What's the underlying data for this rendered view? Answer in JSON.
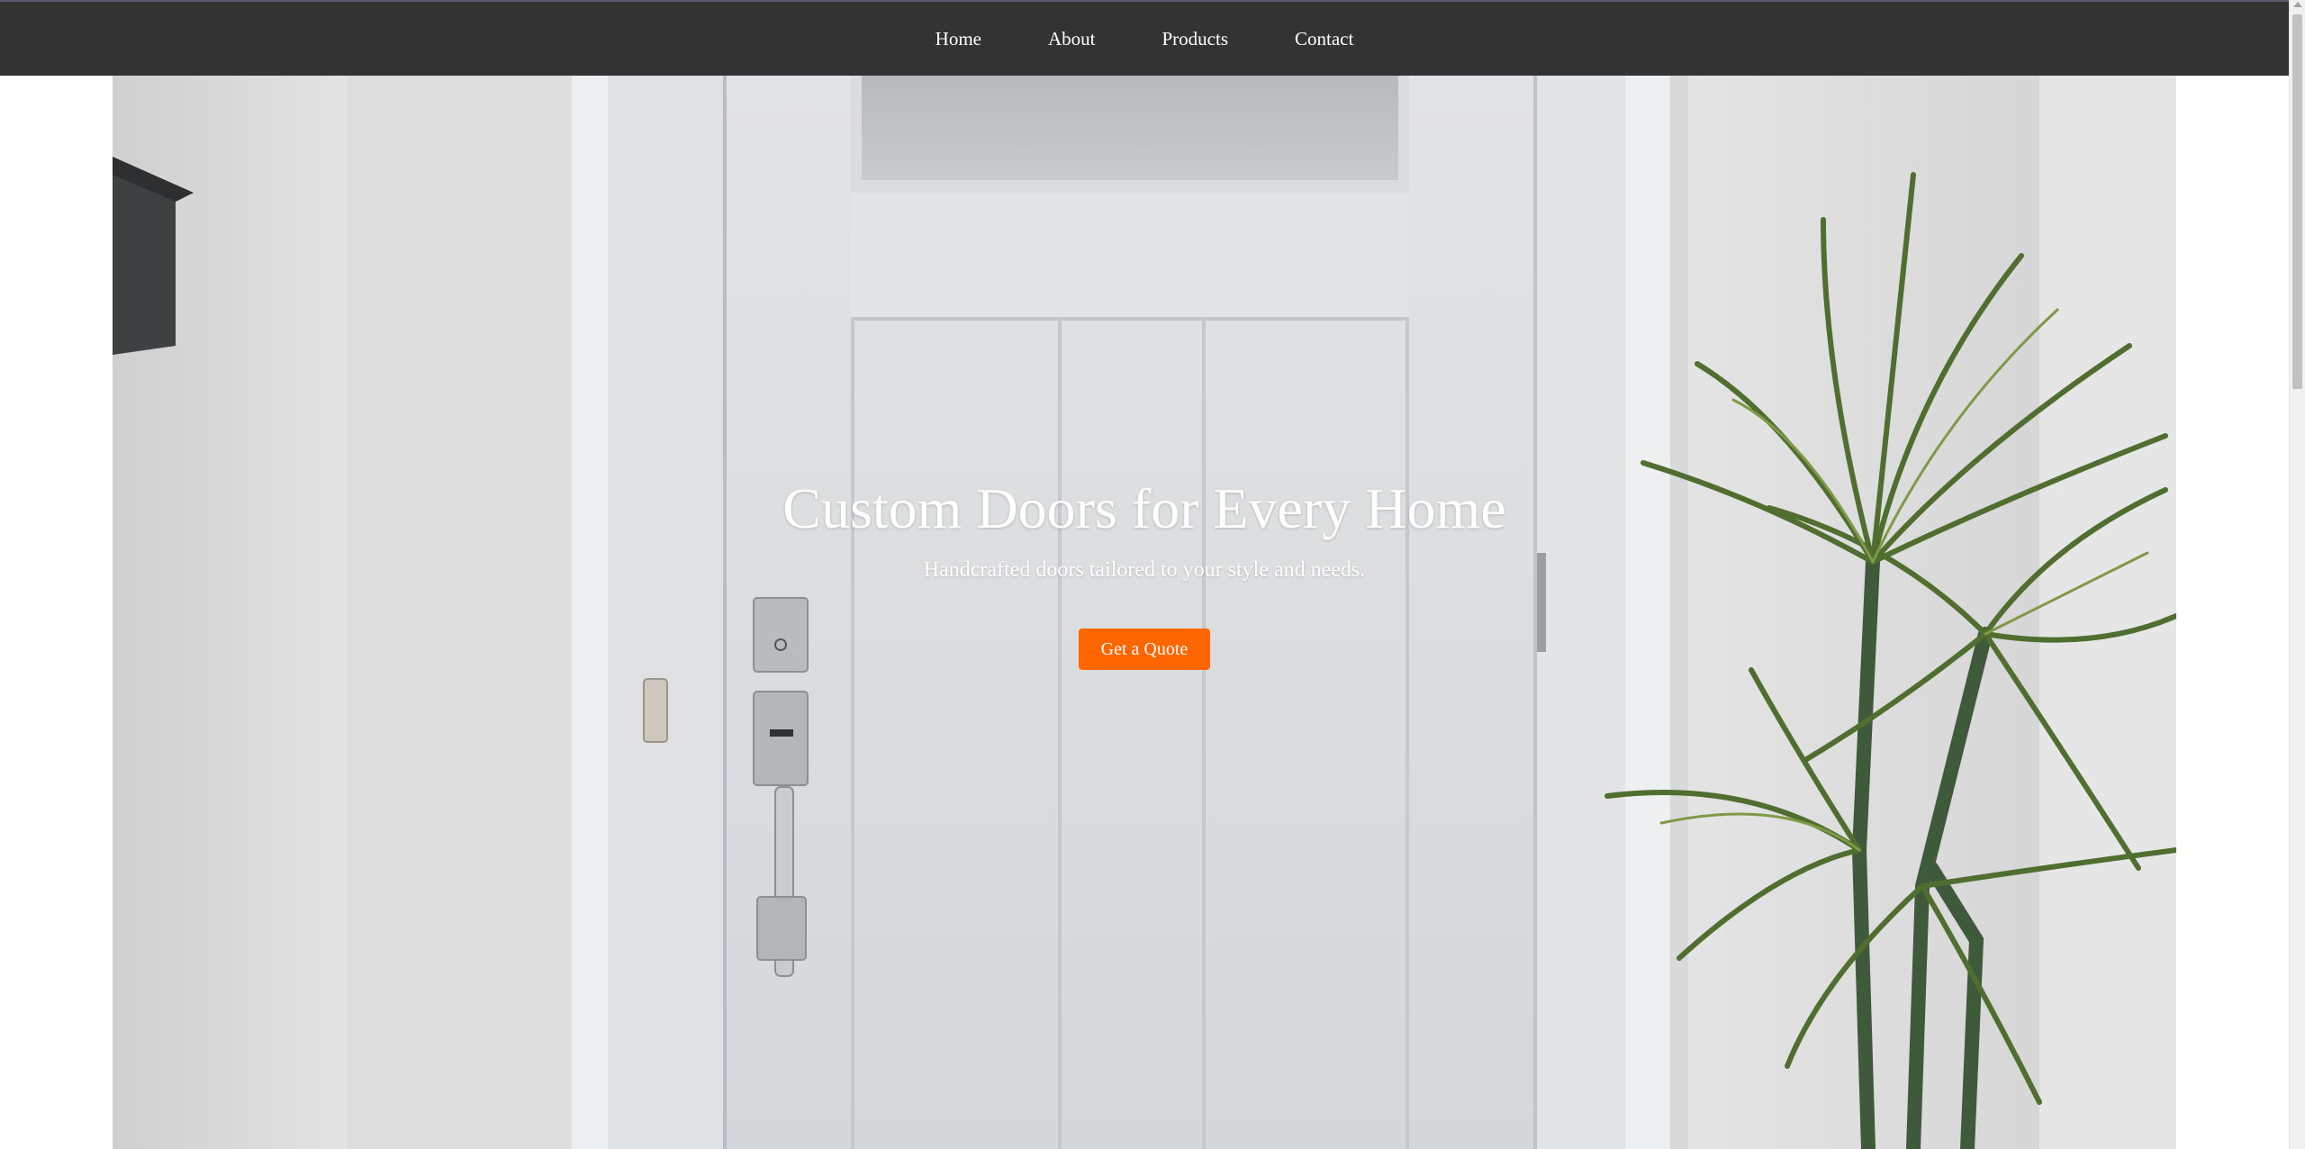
{
  "nav": {
    "items": [
      {
        "label": "Home"
      },
      {
        "label": "About"
      },
      {
        "label": "Products"
      },
      {
        "label": "Contact"
      }
    ]
  },
  "hero": {
    "title": "Custom Doors for Every Home",
    "subtitle": "Handcrafted doors tailored to your style and needs.",
    "cta_label": "Get a Quote",
    "background_image": "white-front-door-with-plant"
  },
  "colors": {
    "nav_bg": "#333333",
    "cta_bg": "#ff6600",
    "text": "#ffffff"
  }
}
